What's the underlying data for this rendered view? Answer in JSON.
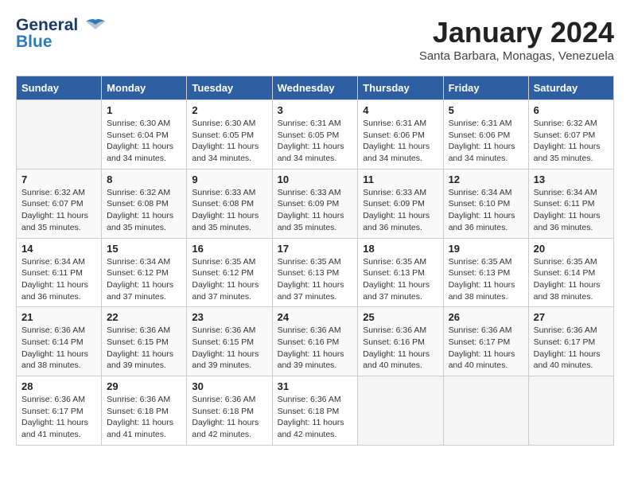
{
  "header": {
    "logo_general": "General",
    "logo_blue": "Blue",
    "month_title": "January 2024",
    "subtitle": "Santa Barbara, Monagas, Venezuela"
  },
  "days_of_week": [
    "Sunday",
    "Monday",
    "Tuesday",
    "Wednesday",
    "Thursday",
    "Friday",
    "Saturday"
  ],
  "weeks": [
    [
      {
        "day": "",
        "info": ""
      },
      {
        "day": "1",
        "info": "Sunrise: 6:30 AM\nSunset: 6:04 PM\nDaylight: 11 hours\nand 34 minutes."
      },
      {
        "day": "2",
        "info": "Sunrise: 6:30 AM\nSunset: 6:05 PM\nDaylight: 11 hours\nand 34 minutes."
      },
      {
        "day": "3",
        "info": "Sunrise: 6:31 AM\nSunset: 6:05 PM\nDaylight: 11 hours\nand 34 minutes."
      },
      {
        "day": "4",
        "info": "Sunrise: 6:31 AM\nSunset: 6:06 PM\nDaylight: 11 hours\nand 34 minutes."
      },
      {
        "day": "5",
        "info": "Sunrise: 6:31 AM\nSunset: 6:06 PM\nDaylight: 11 hours\nand 34 minutes."
      },
      {
        "day": "6",
        "info": "Sunrise: 6:32 AM\nSunset: 6:07 PM\nDaylight: 11 hours\nand 35 minutes."
      }
    ],
    [
      {
        "day": "7",
        "info": "Sunrise: 6:32 AM\nSunset: 6:07 PM\nDaylight: 11 hours\nand 35 minutes."
      },
      {
        "day": "8",
        "info": "Sunrise: 6:32 AM\nSunset: 6:08 PM\nDaylight: 11 hours\nand 35 minutes."
      },
      {
        "day": "9",
        "info": "Sunrise: 6:33 AM\nSunset: 6:08 PM\nDaylight: 11 hours\nand 35 minutes."
      },
      {
        "day": "10",
        "info": "Sunrise: 6:33 AM\nSunset: 6:09 PM\nDaylight: 11 hours\nand 35 minutes."
      },
      {
        "day": "11",
        "info": "Sunrise: 6:33 AM\nSunset: 6:09 PM\nDaylight: 11 hours\nand 36 minutes."
      },
      {
        "day": "12",
        "info": "Sunrise: 6:34 AM\nSunset: 6:10 PM\nDaylight: 11 hours\nand 36 minutes."
      },
      {
        "day": "13",
        "info": "Sunrise: 6:34 AM\nSunset: 6:11 PM\nDaylight: 11 hours\nand 36 minutes."
      }
    ],
    [
      {
        "day": "14",
        "info": "Sunrise: 6:34 AM\nSunset: 6:11 PM\nDaylight: 11 hours\nand 36 minutes."
      },
      {
        "day": "15",
        "info": "Sunrise: 6:34 AM\nSunset: 6:12 PM\nDaylight: 11 hours\nand 37 minutes."
      },
      {
        "day": "16",
        "info": "Sunrise: 6:35 AM\nSunset: 6:12 PM\nDaylight: 11 hours\nand 37 minutes."
      },
      {
        "day": "17",
        "info": "Sunrise: 6:35 AM\nSunset: 6:13 PM\nDaylight: 11 hours\nand 37 minutes."
      },
      {
        "day": "18",
        "info": "Sunrise: 6:35 AM\nSunset: 6:13 PM\nDaylight: 11 hours\nand 37 minutes."
      },
      {
        "day": "19",
        "info": "Sunrise: 6:35 AM\nSunset: 6:13 PM\nDaylight: 11 hours\nand 38 minutes."
      },
      {
        "day": "20",
        "info": "Sunrise: 6:35 AM\nSunset: 6:14 PM\nDaylight: 11 hours\nand 38 minutes."
      }
    ],
    [
      {
        "day": "21",
        "info": "Sunrise: 6:36 AM\nSunset: 6:14 PM\nDaylight: 11 hours\nand 38 minutes."
      },
      {
        "day": "22",
        "info": "Sunrise: 6:36 AM\nSunset: 6:15 PM\nDaylight: 11 hours\nand 39 minutes."
      },
      {
        "day": "23",
        "info": "Sunrise: 6:36 AM\nSunset: 6:15 PM\nDaylight: 11 hours\nand 39 minutes."
      },
      {
        "day": "24",
        "info": "Sunrise: 6:36 AM\nSunset: 6:16 PM\nDaylight: 11 hours\nand 39 minutes."
      },
      {
        "day": "25",
        "info": "Sunrise: 6:36 AM\nSunset: 6:16 PM\nDaylight: 11 hours\nand 40 minutes."
      },
      {
        "day": "26",
        "info": "Sunrise: 6:36 AM\nSunset: 6:17 PM\nDaylight: 11 hours\nand 40 minutes."
      },
      {
        "day": "27",
        "info": "Sunrise: 6:36 AM\nSunset: 6:17 PM\nDaylight: 11 hours\nand 40 minutes."
      }
    ],
    [
      {
        "day": "28",
        "info": "Sunrise: 6:36 AM\nSunset: 6:17 PM\nDaylight: 11 hours\nand 41 minutes."
      },
      {
        "day": "29",
        "info": "Sunrise: 6:36 AM\nSunset: 6:18 PM\nDaylight: 11 hours\nand 41 minutes."
      },
      {
        "day": "30",
        "info": "Sunrise: 6:36 AM\nSunset: 6:18 PM\nDaylight: 11 hours\nand 42 minutes."
      },
      {
        "day": "31",
        "info": "Sunrise: 6:36 AM\nSunset: 6:18 PM\nDaylight: 11 hours\nand 42 minutes."
      },
      {
        "day": "",
        "info": ""
      },
      {
        "day": "",
        "info": ""
      },
      {
        "day": "",
        "info": ""
      }
    ]
  ]
}
